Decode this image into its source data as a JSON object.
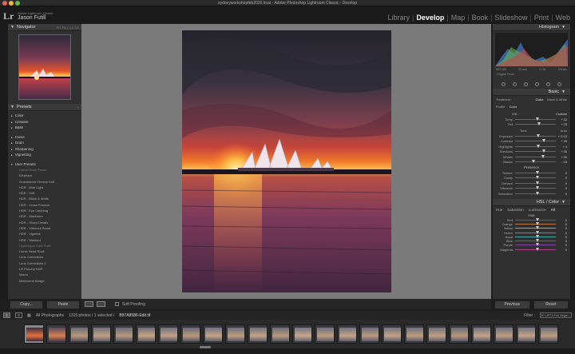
{
  "window": {
    "title": "sydneyworkshopfeb2020.lrcat - Adobe Photoshop Lightroom Classic - Develop"
  },
  "identity": {
    "app": "Adobe Lightroom Classic",
    "user": "Jason Futill",
    "logo": "Lr"
  },
  "modules": [
    "Library",
    "Develop",
    "Map",
    "Book",
    "Slideshow",
    "Print",
    "Web"
  ],
  "left_panel": {
    "navigator_label": "Navigator",
    "navigator_zoom": "FIT  FILL  1:1  3:1",
    "presets_label": "Presets",
    "groups": [
      "Color",
      "Creative",
      "B&W",
      "Curve",
      "Grain",
      "Sharpening",
      "Vignetting",
      "User Presets"
    ],
    "user_presets": [
      "Camel Rock Preset",
      "Elephant",
      "Grandstreet Cheese Edit",
      "HDR - Blue Light",
      "HDR - Soft",
      "HDR - Black & White",
      "HDR - Cross Process",
      "HDR - Eye Catching",
      "HDR - Maximum",
      "HDR - Sharp Details",
      "HDR - Vibrance Boost",
      "HDR - Vignette",
      "HDR - Washed",
      "Hyperlapse Falls Futill",
      "Horse Head Rock",
      "Lens Corrections",
      "Lens Corrections 2",
      "LR Punchy HDR",
      "Macro",
      "Melbourne Bridge"
    ],
    "copy_button": "Copy...",
    "paste_button": "Paste"
  },
  "toolbar": {
    "soft_proofing": "Soft Proofing"
  },
  "right_panel": {
    "histogram_label": "Histogram",
    "hist_info": [
      "ISO 100",
      "22 mm",
      "f / 16",
      "0.5 sec"
    ],
    "original_photo": "Original Photo",
    "basic_label": "Basic",
    "treatment_label": "Treatment :",
    "treatment_color": "Color",
    "treatment_bw": "Black & White",
    "profile_label": "Profile :",
    "profile_value": "Color",
    "wb_label": "WB :",
    "wb_value": "Custom",
    "sliders_wb": [
      {
        "label": "Temp",
        "value": "+ 10"
      },
      {
        "label": "Tint",
        "value": "+ 25"
      }
    ],
    "tone_label": "Tone",
    "tone_auto": "Auto",
    "sliders_tone": [
      {
        "label": "Exposure",
        "value": "+ 0.15"
      },
      {
        "label": "Contrast",
        "value": "+ 35"
      },
      {
        "label": "Highlights",
        "value": "+ 4"
      },
      {
        "label": "Shadows",
        "value": "+ 35"
      },
      {
        "label": "Whites",
        "value": "+ 30"
      },
      {
        "label": "Blacks",
        "value": "- 16"
      }
    ],
    "presence_label": "Presence",
    "sliders_presence": [
      {
        "label": "Texture",
        "value": "0"
      },
      {
        "label": "Clarity",
        "value": "0"
      },
      {
        "label": "Dehaze",
        "value": "0"
      },
      {
        "label": "Vibrance",
        "value": "0"
      },
      {
        "label": "Saturation",
        "value": "0"
      }
    ],
    "hsl_label": "HSL / Color",
    "hsl_tabs": [
      "Hue",
      "Saturation",
      "Luminance",
      "All"
    ],
    "hue_label": "Hue",
    "sliders_hue": [
      {
        "label": "Red",
        "value": "0"
      },
      {
        "label": "Orange",
        "value": "0"
      },
      {
        "label": "Yellow",
        "value": "0"
      },
      {
        "label": "Green",
        "value": "0"
      },
      {
        "label": "Aqua",
        "value": "0"
      },
      {
        "label": "Blue",
        "value": "0"
      },
      {
        "label": "Purple",
        "value": "0"
      },
      {
        "label": "Magenta",
        "value": "0"
      }
    ],
    "previous_button": "Previous",
    "reset_button": "Reset"
  },
  "filmstrip": {
    "monitor1": "1",
    "monitor2": "2",
    "source": "All Photographs",
    "count": "1315 photos / 1 selected /",
    "filename": "B97A8586-Edit.tif",
    "filter_label": "Filter :",
    "filter_preset": "30 LRT3 Full Segm..."
  },
  "colors": {
    "accent": "#ffffff",
    "panel": "#303030",
    "center": "#7a7a7a"
  }
}
